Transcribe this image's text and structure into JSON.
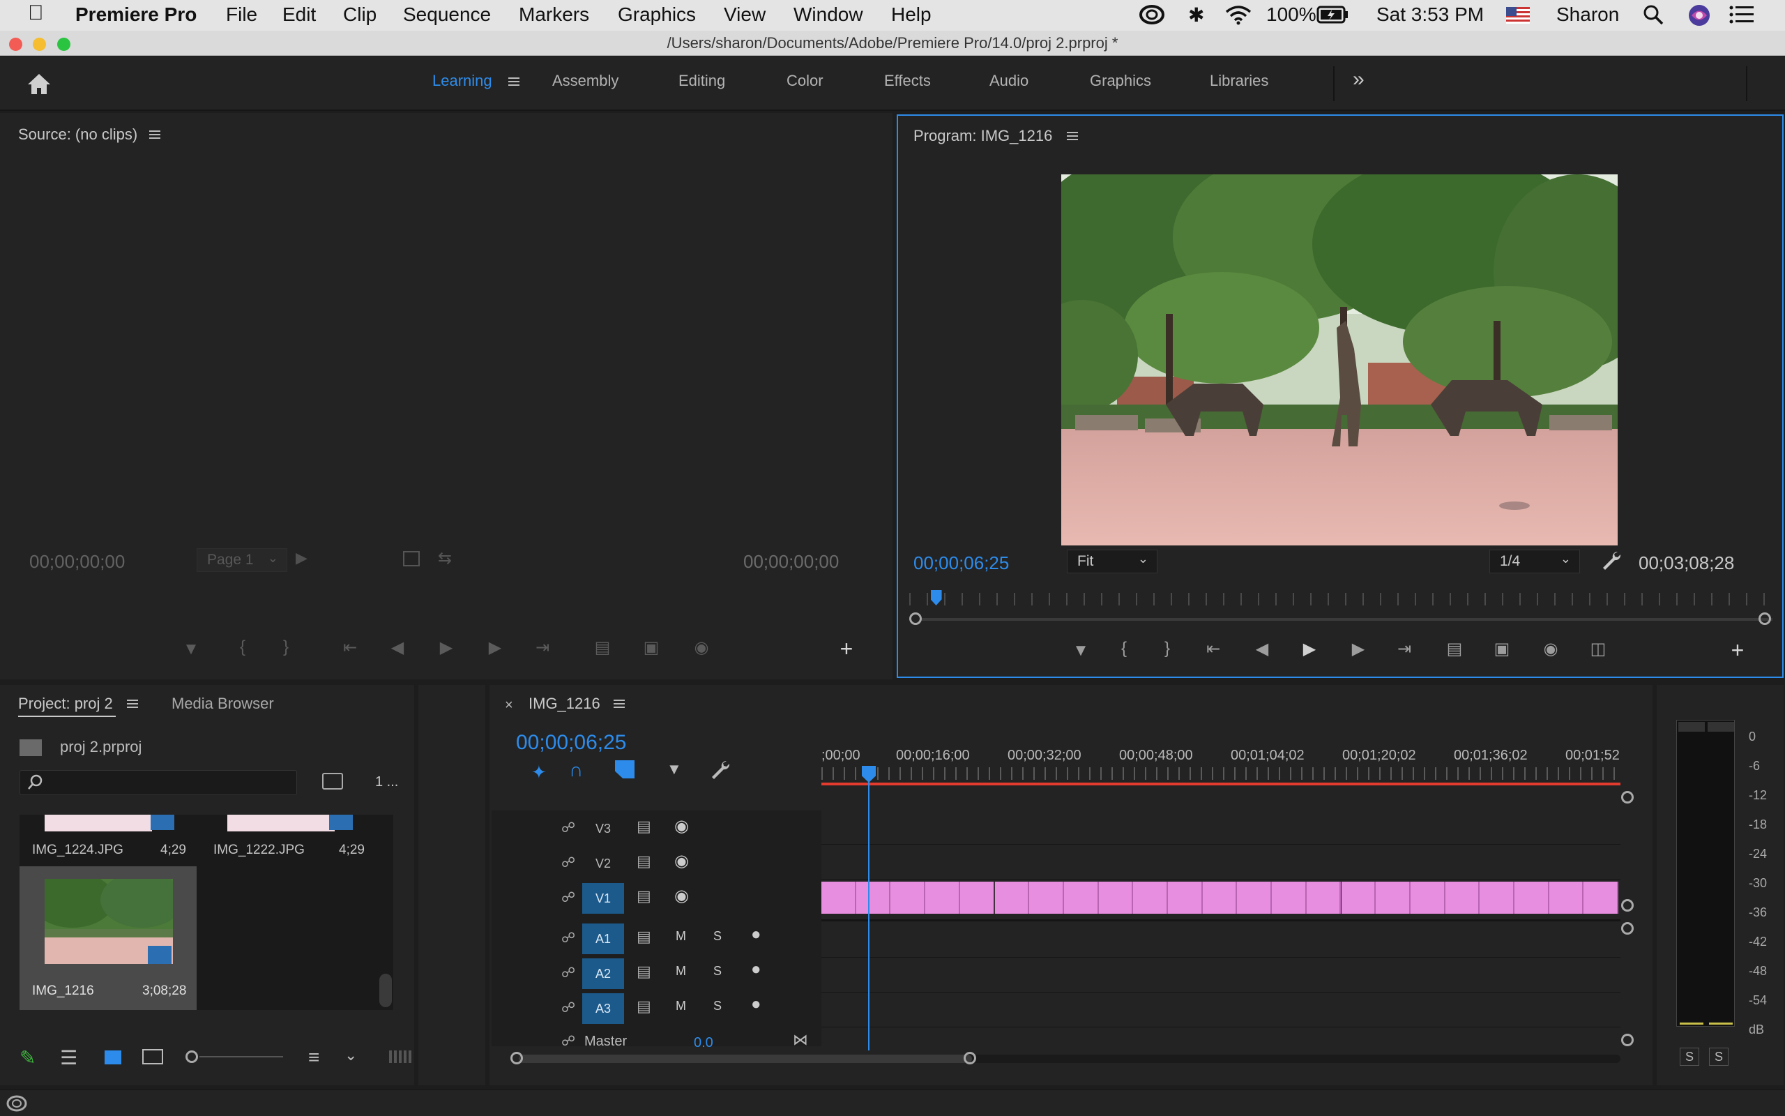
{
  "menubar": {
    "app_name": "Premiere Pro",
    "items": [
      "File",
      "Edit",
      "Clip",
      "Sequence",
      "Markers",
      "Graphics",
      "View",
      "Window",
      "Help"
    ],
    "battery": "100%",
    "clock": "Sat 3:53 PM",
    "user": "Sharon"
  },
  "window": {
    "title": "/Users/sharon/Documents/Adobe/Premiere Pro/14.0/proj 2.prproj *"
  },
  "workspaces": {
    "active": "Learning",
    "items": [
      "Learning",
      "Assembly",
      "Editing",
      "Color",
      "Effects",
      "Audio",
      "Graphics",
      "Libraries"
    ]
  },
  "source": {
    "title": "Source: (no clips)",
    "timecode_in": "00;00;00;00",
    "timecode_out": "00;00;00;00",
    "page_label": "Page 1"
  },
  "program": {
    "title": "Program: IMG_1216",
    "timecode": "00;00;06;25",
    "zoom": "Fit",
    "resolution": "1/4",
    "duration": "00;03;08;28",
    "playhead_fraction": 0.025
  },
  "project": {
    "tab": "Project: proj 2",
    "tab2": "Media Browser",
    "file": "proj 2.prproj",
    "item_count": "1 ...",
    "items": [
      {
        "name": "IMG_1224.JPG",
        "duration": "4;29"
      },
      {
        "name": "IMG_1222.JPG",
        "duration": "4;29"
      },
      {
        "name": "IMG_1216",
        "duration": "3;08;28"
      }
    ]
  },
  "timeline": {
    "tab": "IMG_1216",
    "timecode": "00;00;06;25",
    "ruler": [
      ";00;00",
      "00;00;16;00",
      "00;00;32;00",
      "00;00;48;00",
      "00;01;04;02",
      "00;01;20;02",
      "00;01;36;02",
      "00;01;52"
    ],
    "video_tracks": [
      "V3",
      "V2",
      "V1"
    ],
    "audio_tracks": [
      "A1",
      "A2",
      "A3"
    ],
    "master_label": "Master",
    "master_value": "0.0",
    "mute": "M",
    "solo": "S"
  },
  "meter": {
    "scale": [
      "0",
      "-6",
      "-12",
      "-18",
      "-24",
      "-30",
      "-36",
      "-42",
      "-48",
      "-54",
      "dB"
    ],
    "solo_left": "S",
    "solo_right": "S"
  },
  "colors": {
    "accent": "#2d8ceb",
    "clip": "#e88ee0",
    "ruler_in_out": "#e33b2e"
  }
}
